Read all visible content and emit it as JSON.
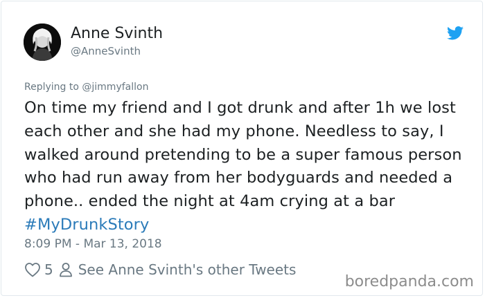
{
  "author": {
    "name": "Anne Svinth",
    "handle": "@AnneSvinth"
  },
  "reply": {
    "prefix": "Replying to",
    "to": "@jimmyfallon"
  },
  "tweet": {
    "text": "On time my friend and I got drunk and after 1h we lost each other and she had my phone. Needless to say, I walked around pretending to be a super famous person who had run away from her bodyguards and needed a phone.. ended the night at 4am crying at a bar ",
    "hashtag": "#MyDrunkStory",
    "timestamp": "8:09 PM - Mar 13, 2018"
  },
  "actions": {
    "likes": "5",
    "other_tweets_label": "See Anne Svinth's other Tweets"
  },
  "watermark": "boredpanda.com",
  "icons": {
    "brand": "twitter-bird-icon",
    "like": "heart-icon",
    "profile": "person-icon"
  },
  "colors": {
    "brand": "#1da1f2",
    "hashtag": "#2b7bb9",
    "meta": "#697882"
  }
}
